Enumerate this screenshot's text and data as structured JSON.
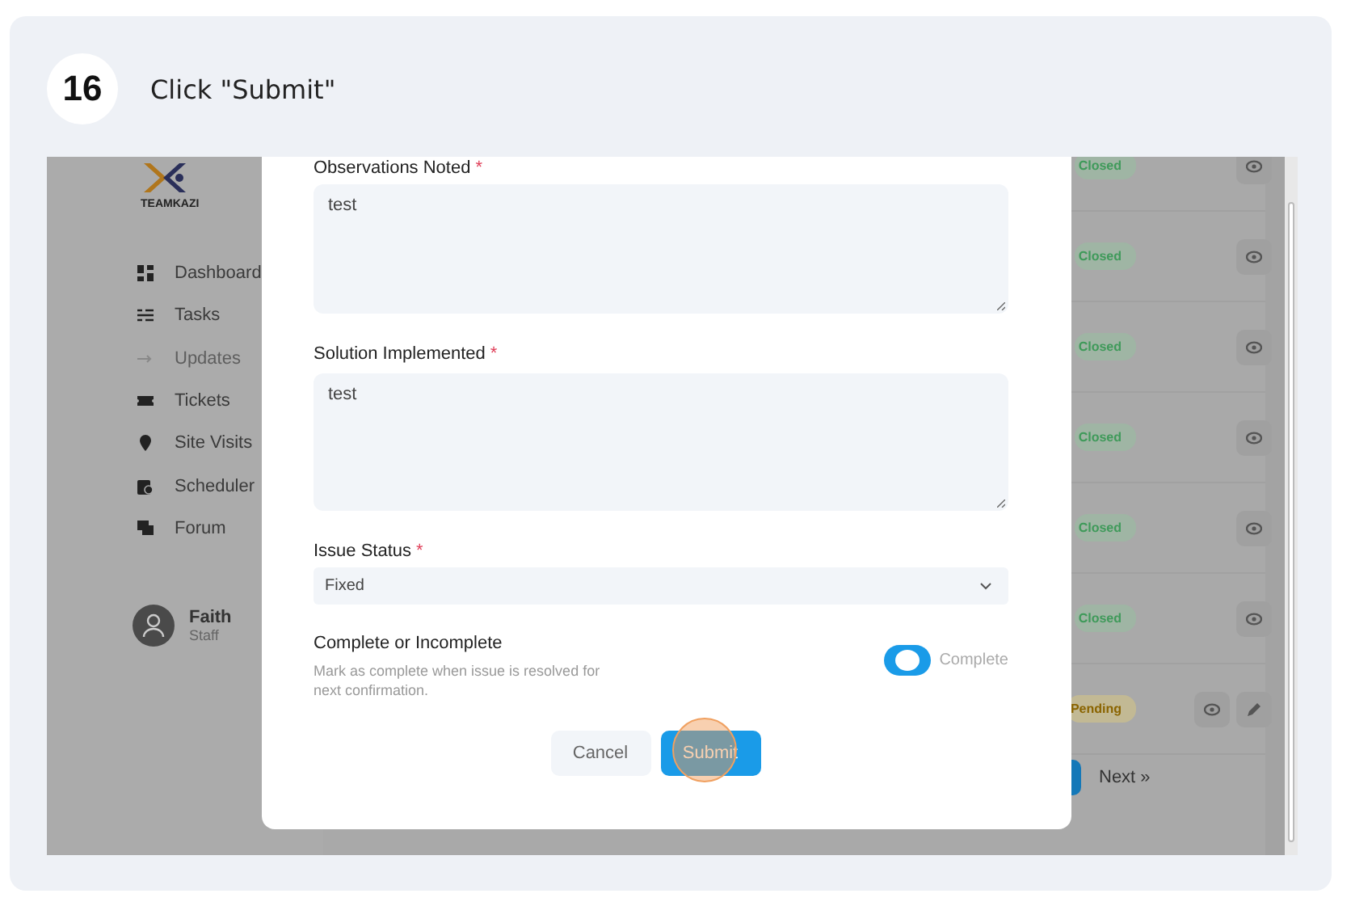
{
  "step": {
    "number": "16",
    "instruction": "Click \"Submit\""
  },
  "sidebar": {
    "logo_text": "TEAMKAZI",
    "items": [
      {
        "label": "Dashboard",
        "disabled": false
      },
      {
        "label": "Tasks",
        "disabled": false
      },
      {
        "label": "Updates",
        "disabled": true
      },
      {
        "label": "Tickets",
        "disabled": false
      },
      {
        "label": "Site Visits",
        "disabled": false
      },
      {
        "label": "Scheduler",
        "disabled": false
      },
      {
        "label": "Forum",
        "disabled": false
      }
    ],
    "user": {
      "name": "Faith",
      "role": "Staff"
    }
  },
  "table": {
    "rows": [
      {
        "status": "Closed",
        "kind": "closed",
        "editable": false
      },
      {
        "status": "Closed",
        "kind": "closed",
        "editable": false
      },
      {
        "status": "Closed",
        "kind": "closed",
        "editable": false
      },
      {
        "status": "Closed",
        "kind": "closed",
        "editable": false
      },
      {
        "status": "Closed",
        "kind": "closed",
        "editable": false
      },
      {
        "status": "Closed",
        "kind": "closed",
        "editable": false
      },
      {
        "status": "Pending",
        "kind": "pending",
        "editable": true
      }
    ]
  },
  "pagination": {
    "next": "Next »"
  },
  "modal": {
    "fields": [
      {
        "kind": "textarea",
        "label": "Observations Noted",
        "required_mark": "*",
        "value": "test"
      },
      {
        "kind": "textarea",
        "label": "Solution Implemented",
        "required_mark": "*",
        "value": "test"
      },
      {
        "kind": "select",
        "label": "Issue Status",
        "required_mark": "*",
        "value": "Fixed"
      }
    ],
    "completion": {
      "title": "Complete or Incomplete",
      "description": "Mark as complete when issue is resolved for next confirmation.",
      "on": true,
      "label": "Complete"
    },
    "buttons": [
      {
        "label": "Cancel",
        "kind": "secondary",
        "highlighted": false
      },
      {
        "label": "Submit",
        "kind": "primary",
        "highlighted": true
      }
    ]
  }
}
